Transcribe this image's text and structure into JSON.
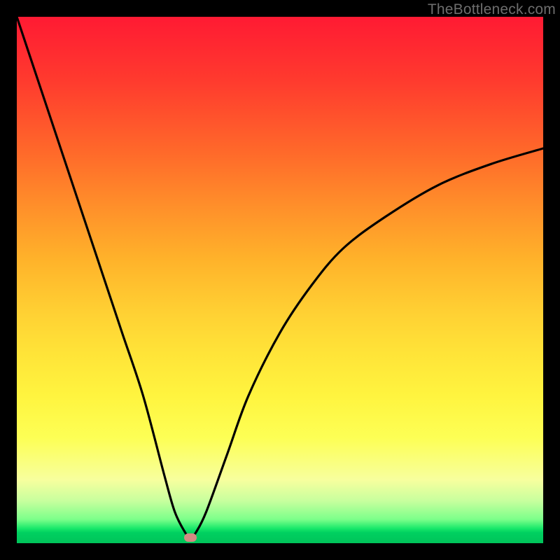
{
  "watermark": "TheBottleneck.com",
  "chart_data": {
    "type": "line",
    "title": "",
    "xlabel": "",
    "ylabel": "",
    "xlim": [
      0,
      100
    ],
    "ylim": [
      0,
      100
    ],
    "grid": false,
    "legend": false,
    "background_gradient": {
      "stops": [
        {
          "pos": 0,
          "color": "#ff1a33"
        },
        {
          "pos": 50,
          "color": "#ffc030"
        },
        {
          "pos": 80,
          "color": "#fdff55"
        },
        {
          "pos": 97,
          "color": "#19e86a"
        },
        {
          "pos": 100,
          "color": "#00c45a"
        }
      ]
    },
    "series": [
      {
        "name": "bottleneck-curve",
        "x": [
          0,
          4,
          8,
          12,
          16,
          20,
          24,
          28,
          30,
          32,
          33,
          34,
          36,
          40,
          44,
          50,
          56,
          62,
          70,
          80,
          90,
          100
        ],
        "y": [
          100,
          88,
          76,
          64,
          52,
          40,
          28,
          13,
          6,
          2,
          1,
          2,
          6,
          17,
          28,
          40,
          49,
          56,
          62,
          68,
          72,
          75
        ]
      }
    ],
    "marker": {
      "x": 33,
      "y": 1,
      "color": "#d48a83"
    }
  }
}
